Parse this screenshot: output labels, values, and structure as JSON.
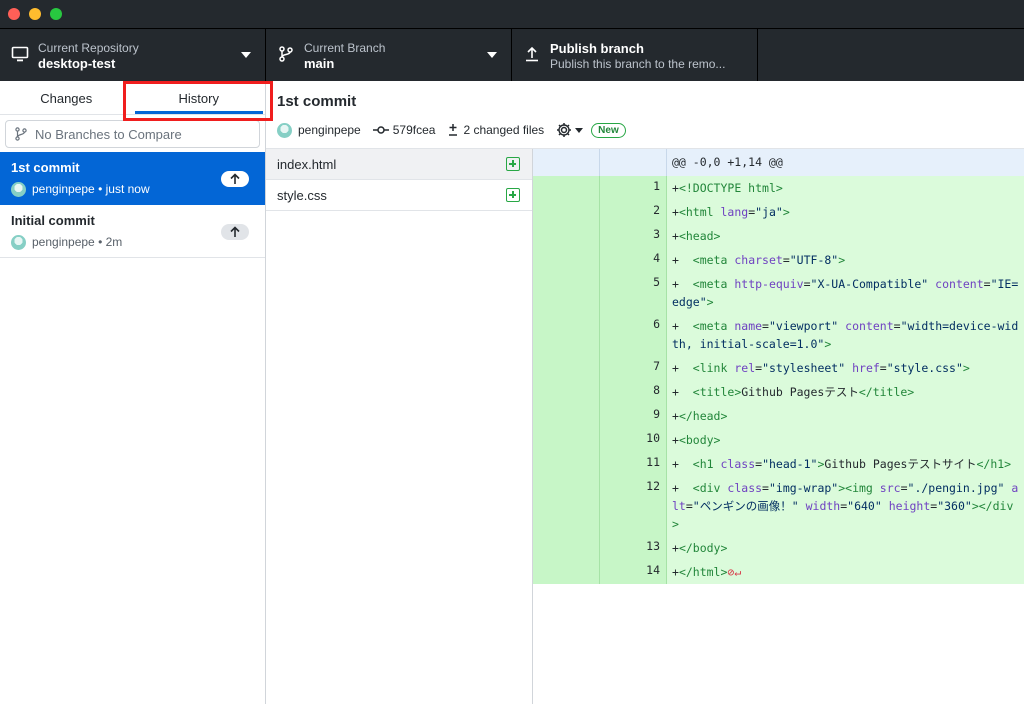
{
  "toolbar": {
    "repo_label": "Current Repository",
    "repo_value": "desktop-test",
    "branch_label": "Current Branch",
    "branch_value": "main",
    "publish_label": "Publish branch",
    "publish_desc": "Publish this branch to the remo..."
  },
  "sidebar": {
    "tabs": [
      {
        "label": "Changes"
      },
      {
        "label": "History"
      }
    ],
    "compare_placeholder": "No Branches to Compare",
    "commits": [
      {
        "title": "1st commit",
        "author": "penginpepe",
        "time": "just now"
      },
      {
        "title": "Initial commit",
        "author": "penginpepe",
        "time": "2m"
      }
    ]
  },
  "commit": {
    "title": "1st commit",
    "author": "penginpepe",
    "sha": "579fcea",
    "changed_files": "2 changed files",
    "new_badge": "New"
  },
  "files": [
    {
      "name": "index.html"
    },
    {
      "name": "style.css"
    }
  ],
  "diff": {
    "hunk": "@@ -0,0 +1,14 @@",
    "lines": [
      {
        "num": "1",
        "html": "+<span class='tg'>&lt;!DOCTYPE html&gt;</span>"
      },
      {
        "num": "2",
        "html": "+<span class='tg'>&lt;html</span> <span class='at'>lang</span>=<span class='st'>\"ja\"</span><span class='tg'>&gt;</span>"
      },
      {
        "num": "3",
        "html": "+<span class='tg'>&lt;head&gt;</span>"
      },
      {
        "num": "4",
        "html": "+  <span class='tg'>&lt;meta</span> <span class='at'>charset</span>=<span class='st'>\"UTF-8\"</span><span class='tg'>&gt;</span>"
      },
      {
        "num": "5",
        "html": "+  <span class='tg'>&lt;meta</span> <span class='at'>http-equiv</span>=<span class='st'>\"X-UA-Compatible\"</span> <span class='at'>content</span>=<span class='st'>\"IE=edge\"</span><span class='tg'>&gt;</span>"
      },
      {
        "num": "6",
        "html": "+  <span class='tg'>&lt;meta</span> <span class='at'>name</span>=<span class='st'>\"viewport\"</span> <span class='at'>content</span>=<span class='st'>\"width=device-width, initial-scale=1.0\"</span><span class='tg'>&gt;</span>"
      },
      {
        "num": "7",
        "html": "+  <span class='tg'>&lt;link</span> <span class='at'>rel</span>=<span class='st'>\"stylesheet\"</span> <span class='at'>href</span>=<span class='st'>\"style.css\"</span><span class='tg'>&gt;</span>"
      },
      {
        "num": "8",
        "html": "+  <span class='tg'>&lt;title&gt;</span>Github Pagesテスト<span class='tg'>&lt;/title&gt;</span>"
      },
      {
        "num": "9",
        "html": "+<span class='tg'>&lt;/head&gt;</span>"
      },
      {
        "num": "10",
        "html": "+<span class='tg'>&lt;body&gt;</span>"
      },
      {
        "num": "11",
        "html": "+  <span class='tg'>&lt;h1</span> <span class='at'>class</span>=<span class='st'>\"head-1\"</span><span class='tg'>&gt;</span>Github Pagesテストサイト<span class='tg'>&lt;/h1&gt;</span>"
      },
      {
        "num": "12",
        "html": "+  <span class='tg'>&lt;div</span> <span class='at'>class</span>=<span class='st'>\"img-wrap\"</span><span class='tg'>&gt;&lt;img</span> <span class='at'>src</span>=<span class='st'>\"./pengin.jpg\"</span> <span class='at'>alt</span>=<span class='st'>\"ペンギンの画像！\"</span> <span class='at'>width</span>=<span class='st'>\"640\"</span> <span class='at'>height</span>=<span class='st'>\"360\"</span><span class='tg'>&gt;&lt;/div&gt;</span>"
      },
      {
        "num": "13",
        "html": "+<span class='tg'>&lt;/body&gt;</span>"
      },
      {
        "num": "14",
        "html": "+<span class='tg'>&lt;/html&gt;</span><span class='eol'>⊘↵</span>"
      }
    ]
  }
}
